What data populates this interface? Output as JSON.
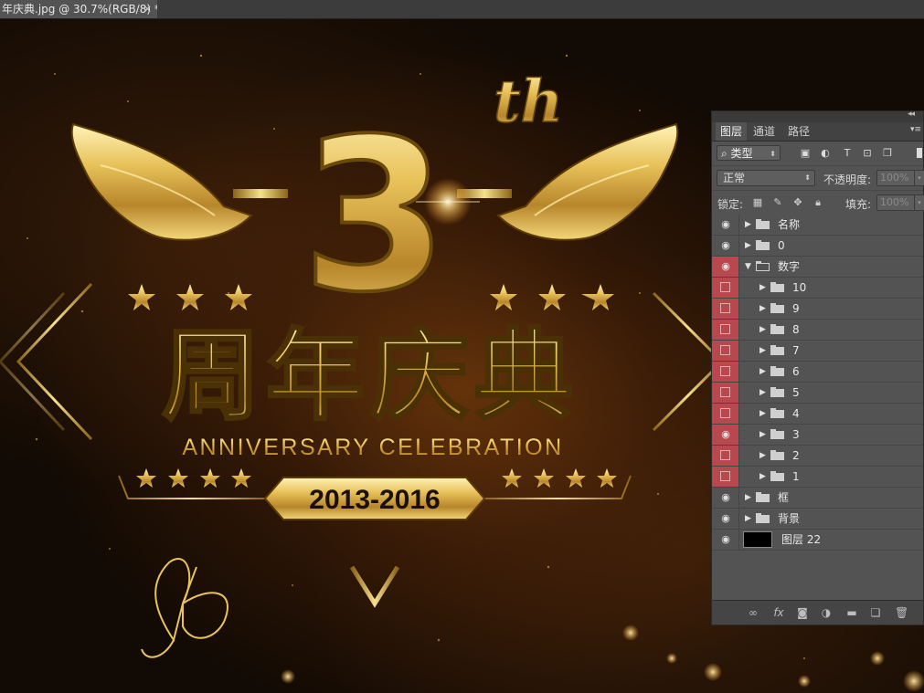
{
  "document": {
    "tab_title": "年庆典.jpg @ 30.7%(RGB/8) *",
    "close_glyph": "×"
  },
  "artwork": {
    "big_number": "3",
    "superscript": "th",
    "title_cn": "周年庆典",
    "subtitle_en": "ANNIVERSARY CELEBRATION",
    "years": "2013-2016",
    "colors": {
      "gold": "#e8c25a",
      "gold_dark": "#8a6316",
      "bg": "#120a04",
      "amber": "#a0500f"
    }
  },
  "layers_panel": {
    "tabs": [
      {
        "label": "图层",
        "active": true
      },
      {
        "label": "通道",
        "active": false
      },
      {
        "label": "路径",
        "active": false
      }
    ],
    "filter_label": "类型",
    "blend_mode": "正常",
    "opacity_label": "不透明度:",
    "opacity_value": "100%",
    "lock_label": "锁定:",
    "fill_label": "填充:",
    "fill_value": "100%",
    "layers": [
      {
        "name": "名称",
        "type": "group",
        "visible": true,
        "indent": 0,
        "red": false
      },
      {
        "name": "0",
        "type": "group",
        "visible": true,
        "indent": 0,
        "red": false
      },
      {
        "name": "数字",
        "type": "group-open",
        "visible": true,
        "indent": 0,
        "red": true
      },
      {
        "name": "10",
        "type": "group",
        "visible": false,
        "indent": 1,
        "red": true
      },
      {
        "name": "9",
        "type": "group",
        "visible": false,
        "indent": 1,
        "red": true
      },
      {
        "name": "8",
        "type": "group",
        "visible": false,
        "indent": 1,
        "red": true
      },
      {
        "name": "7",
        "type": "group",
        "visible": false,
        "indent": 1,
        "red": true
      },
      {
        "name": "6",
        "type": "group",
        "visible": false,
        "indent": 1,
        "red": true
      },
      {
        "name": "5",
        "type": "group",
        "visible": false,
        "indent": 1,
        "red": true
      },
      {
        "name": "4",
        "type": "group",
        "visible": false,
        "indent": 1,
        "red": true
      },
      {
        "name": "3",
        "type": "group",
        "visible": true,
        "indent": 1,
        "red": true
      },
      {
        "name": "2",
        "type": "group",
        "visible": false,
        "indent": 1,
        "red": true
      },
      {
        "name": "1",
        "type": "group",
        "visible": false,
        "indent": 1,
        "red": true
      },
      {
        "name": "框",
        "type": "group",
        "visible": true,
        "indent": 0,
        "red": false
      },
      {
        "name": "背景",
        "type": "group",
        "visible": true,
        "indent": 0,
        "red": false
      },
      {
        "name": "图层 22",
        "type": "layer",
        "visible": true,
        "indent": 0,
        "red": false
      }
    ],
    "bottom_icons": [
      "link-icon",
      "fx-icon",
      "mask-icon",
      "adjustment-icon",
      "new-group-icon",
      "new-layer-icon",
      "trash-icon"
    ]
  }
}
